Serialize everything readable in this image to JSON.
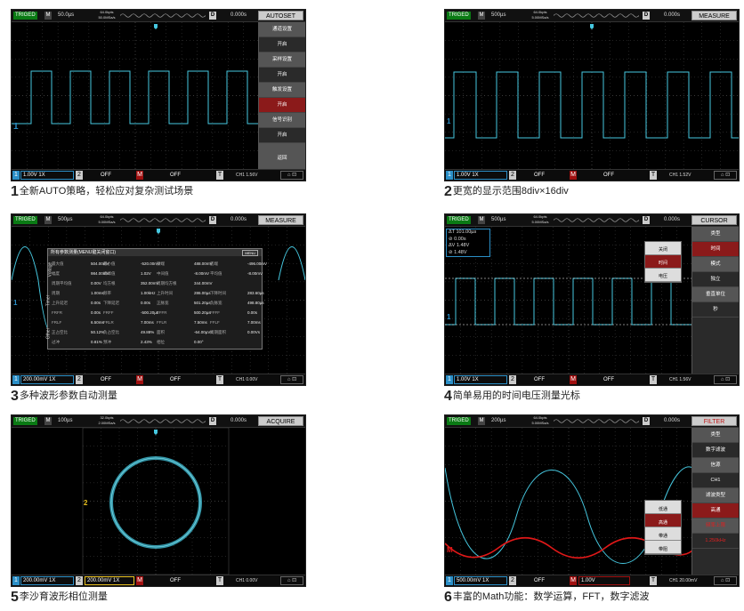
{
  "panels": [
    {
      "top_bar": {
        "trig": "TRIGED",
        "m": "M",
        "timebase": "50.0µs",
        "sample_rate": "64.0kpts\n50.0MSa/s",
        "d": "D",
        "delay": "0.000s",
        "menu_title": "AUTOSET"
      },
      "bottom_bar": {
        "ch1": "1",
        "ch1_val": "1.00V 1X",
        "ch2": "2",
        "ch2_off": "OFF",
        "math_label": "M",
        "math_val": "OFF",
        "trig": "T",
        "trig_val": "CH1 1.56V"
      },
      "menu": [
        "通道设置",
        "开启",
        "采样设置",
        "开启",
        "触发设置",
        "开启",
        "信号识别",
        "开启",
        "返回"
      ],
      "caption_num": "1",
      "caption": "全新AUTO策略，轻松应对复杂测试场景"
    },
    {
      "top_bar": {
        "trig": "TRIGED",
        "m": "M",
        "timebase": "500µs",
        "sample_rate": "64.0kpts\n5.00MSa/s",
        "d": "D",
        "delay": "0.000s",
        "menu_title": "MEASURE"
      },
      "bottom_bar": {
        "ch1": "1",
        "ch1_val": "1.00V 1X",
        "ch2": "2",
        "ch2_off": "OFF",
        "math_label": "M",
        "math_val": "OFF",
        "trig": "T",
        "trig_val": "CH1 1.52V"
      },
      "caption_num": "2",
      "caption": "更宽的显示范围8div×16div"
    },
    {
      "top_bar": {
        "trig": "TRIGED",
        "m": "M",
        "timebase": "500µs",
        "sample_rate": "64.0kpts\n5.00MSa/s",
        "d": "D",
        "delay": "0.000s",
        "menu_title": "MEASURE"
      },
      "bottom_bar": {
        "ch1": "1",
        "ch1_val": "200.00mV 1X",
        "ch2": "2",
        "ch2_off": "OFF",
        "math_label": "M",
        "math_val": "OFF",
        "trig": "T",
        "trig_val": "CH1 0.00V"
      },
      "table": {
        "title": "所有参数测量(MENU键关闭窗口)",
        "menu_tag": "MENU",
        "side_labels": [
          "Voltage",
          "Timer",
          "Other"
        ],
        "rows": [
          [
            "最大值",
            "504.00mV",
            "最小值",
            "-520.00mV",
            "顶端",
            "488.00mV",
            "底端",
            "-496.00mV"
          ],
          [
            "幅度",
            "984.00mV",
            "峰峰值",
            "1.02V",
            "中间值",
            "-8.00mV",
            "平均值",
            "-8.00mV"
          ],
          [
            "周期平均值",
            "0.00V",
            "均方根",
            "352.00mV",
            "周期均方根",
            "344.00mV",
            "",
            ""
          ],
          [
            "周期",
            "1.00ms",
            "频率",
            "1.00kHz",
            "上升时间",
            "286.00µs",
            "下降时间",
            "283.60µs"
          ],
          [
            "上升延迟",
            "0.00s",
            "下降延迟",
            "0.00s",
            "正脉宽",
            "501.20µs",
            "负脉宽",
            "498.80µs"
          ],
          [
            "FRFR",
            "0.00s",
            "FRFF",
            "-500.20µs",
            "FFFR",
            "500.20µs",
            "FFFF",
            "0.00s"
          ],
          [
            "FRLF",
            "6.50ms",
            "FRLR",
            "7.00ms",
            "FFLR",
            "7.50ms",
            "FFLF",
            "7.00ms"
          ],
          [
            "正占空比",
            "50.12%",
            "负占空比",
            "49.88%",
            "面积",
            "-64.00µVs",
            "周期面积",
            "0.00Vs"
          ],
          [
            "过冲",
            "0.81%",
            "预冲",
            "2.43%",
            "相位",
            "0.00°",
            "",
            ""
          ]
        ]
      },
      "caption_num": "3",
      "caption": "多种波形参数自动测量"
    },
    {
      "top_bar": {
        "trig": "TRIGED",
        "m": "M",
        "timebase": "500µs",
        "sample_rate": "64.0kpts\n5.00MSa/s",
        "d": "D",
        "delay": "0.000s",
        "menu_title": "CURSOR"
      },
      "bottom_bar": {
        "ch1": "1",
        "ch1_val": "1.00V 1X",
        "ch2": "2",
        "ch2_off": "OFF",
        "math_label": "M",
        "math_val": "OFF",
        "trig": "T",
        "trig_val": "CH1 1.56V"
      },
      "cursor_readout": [
        "ΔT 101.00µs",
        "⊘ 0.00s",
        "ΔV 1.48V",
        "⊘ 1.48V"
      ],
      "submenu": [
        "关闭",
        "时间",
        "电压"
      ],
      "menu": [
        "类型",
        "时间",
        "模式",
        "独立",
        "垂直单位",
        "秒"
      ],
      "caption_num": "4",
      "caption": "简单易用的时间电压测量光标"
    },
    {
      "top_bar": {
        "trig": "TRIGED",
        "m": "M",
        "timebase": "100µs",
        "sample_rate": "32.0kpts\n2.00MSa/s",
        "d": "D",
        "delay": "0.000s",
        "menu_title": "ACQUIRE"
      },
      "bottom_bar": {
        "ch1": "1",
        "ch1_val": "200.00mV 1X",
        "ch2": "2",
        "ch2_off": "200.00mV 1X",
        "math_label": "M",
        "math_val": "OFF",
        "trig": "T",
        "trig_val": "CH1 0.00V"
      },
      "caption_num": "5",
      "caption": "李沙育波形相位测量"
    },
    {
      "top_bar": {
        "trig": "TRIGED",
        "m": "M",
        "timebase": "200µs",
        "sample_rate": "64.0kpts\n5.00MSa/s",
        "d": "D",
        "delay": "0.000s",
        "menu_title": "FILTER"
      },
      "bottom_bar": {
        "ch1": "1",
        "ch1_val": "500.00mV 1X",
        "ch2": "2",
        "ch2_off": "OFF",
        "math_label": "M",
        "math_val": "1.00V",
        "trig": "T",
        "trig_val": "CH1 20.00mV"
      },
      "submenu": [
        "低通",
        "高通",
        "带通",
        "带阻"
      ],
      "menu": [
        "类型",
        "数字滤波",
        "信源",
        "CH1",
        "滤波类型",
        "高通",
        "频率上限",
        "1.250kHz"
      ],
      "caption_num": "6",
      "caption": "丰富的Math功能：数学运算，FFT，数字滤波"
    }
  ],
  "colors": {
    "ch1": "#46c8e0",
    "math": "#e01818",
    "accent": "#8b1a1a",
    "ch1_marker": "#2b8fc7"
  }
}
